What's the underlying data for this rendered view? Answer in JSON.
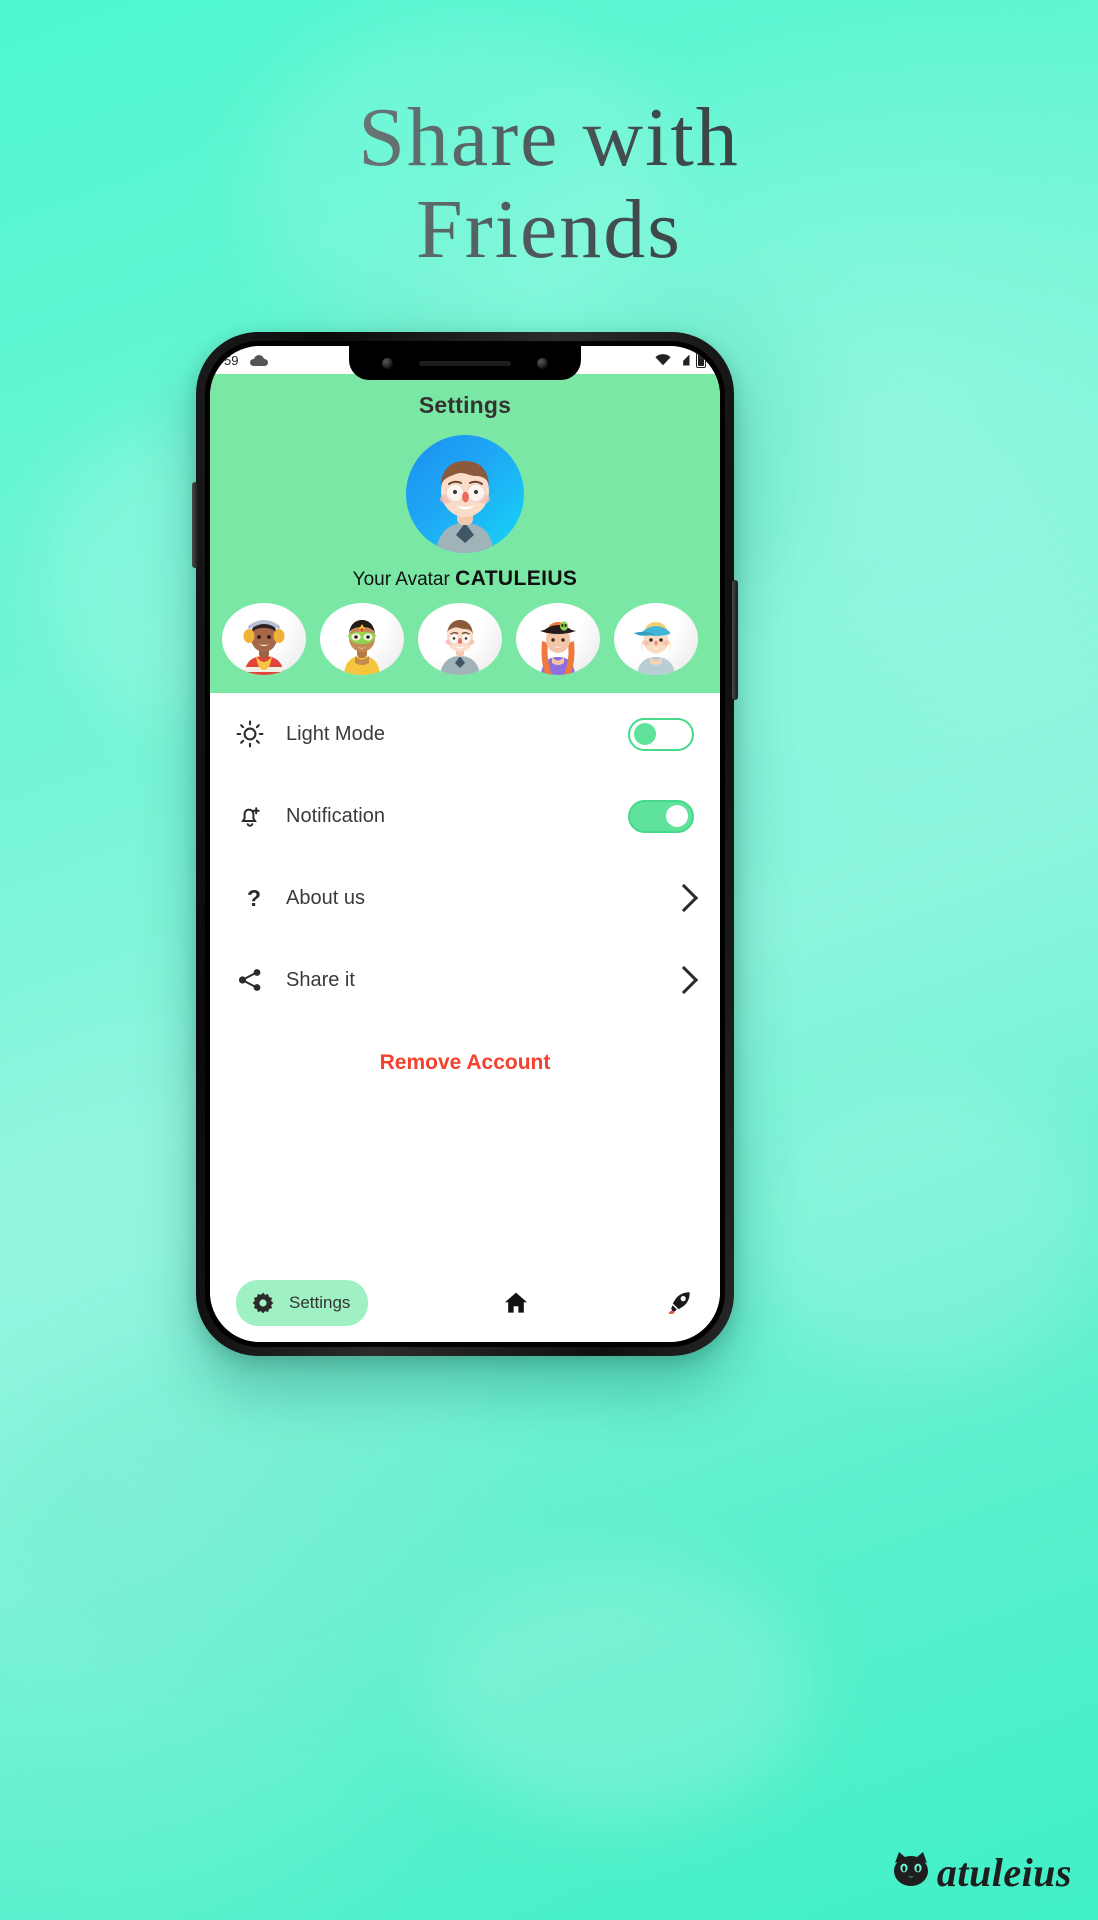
{
  "promo": {
    "headline_line1": "Share with",
    "headline_line2": "Friends",
    "background_color": "#6df2d0"
  },
  "phone": {
    "statusbar": {
      "time": "59",
      "cloud_icon": "cloud-icon",
      "wifi_icon": "wifi-icon",
      "signal_icon": "signal-icon",
      "battery_icon": "battery-icon"
    },
    "header": {
      "title": "Settings",
      "accent_color": "#7AE8A4",
      "avatar_caption_prefix": "Your Avatar",
      "avatar_name": "CATULEIUS",
      "main_avatar_name": "avatar-boy-glasses"
    },
    "avatar_choices": [
      {
        "name": "avatar-headphones-scarf"
      },
      {
        "name": "avatar-green-mask"
      },
      {
        "name": "avatar-boy-glasses"
      },
      {
        "name": "avatar-redhair-hat"
      },
      {
        "name": "avatar-blond-cap"
      }
    ],
    "settings_rows": [
      {
        "icon": "sun-icon",
        "label": "Light Mode",
        "control": "toggle",
        "value": "off"
      },
      {
        "icon": "notification-icon",
        "label": "Notification",
        "control": "toggle",
        "value": "on"
      },
      {
        "icon": "question-icon",
        "label": "About us",
        "control": "chevron"
      },
      {
        "icon": "share-icon",
        "label": "Share it",
        "control": "chevron"
      }
    ],
    "danger_action": {
      "label": "Remove Account",
      "color": "#f4402e"
    },
    "bottom_nav": [
      {
        "name": "nav-settings",
        "icon": "gear-icon",
        "label": "Settings",
        "active": true
      },
      {
        "name": "nav-home",
        "icon": "home-icon",
        "label": "",
        "active": false
      },
      {
        "name": "nav-rocket",
        "icon": "rocket-icon",
        "label": "",
        "active": false
      }
    ]
  },
  "watermark": {
    "brand": "atuleius",
    "logo": "cat-logo-icon"
  }
}
